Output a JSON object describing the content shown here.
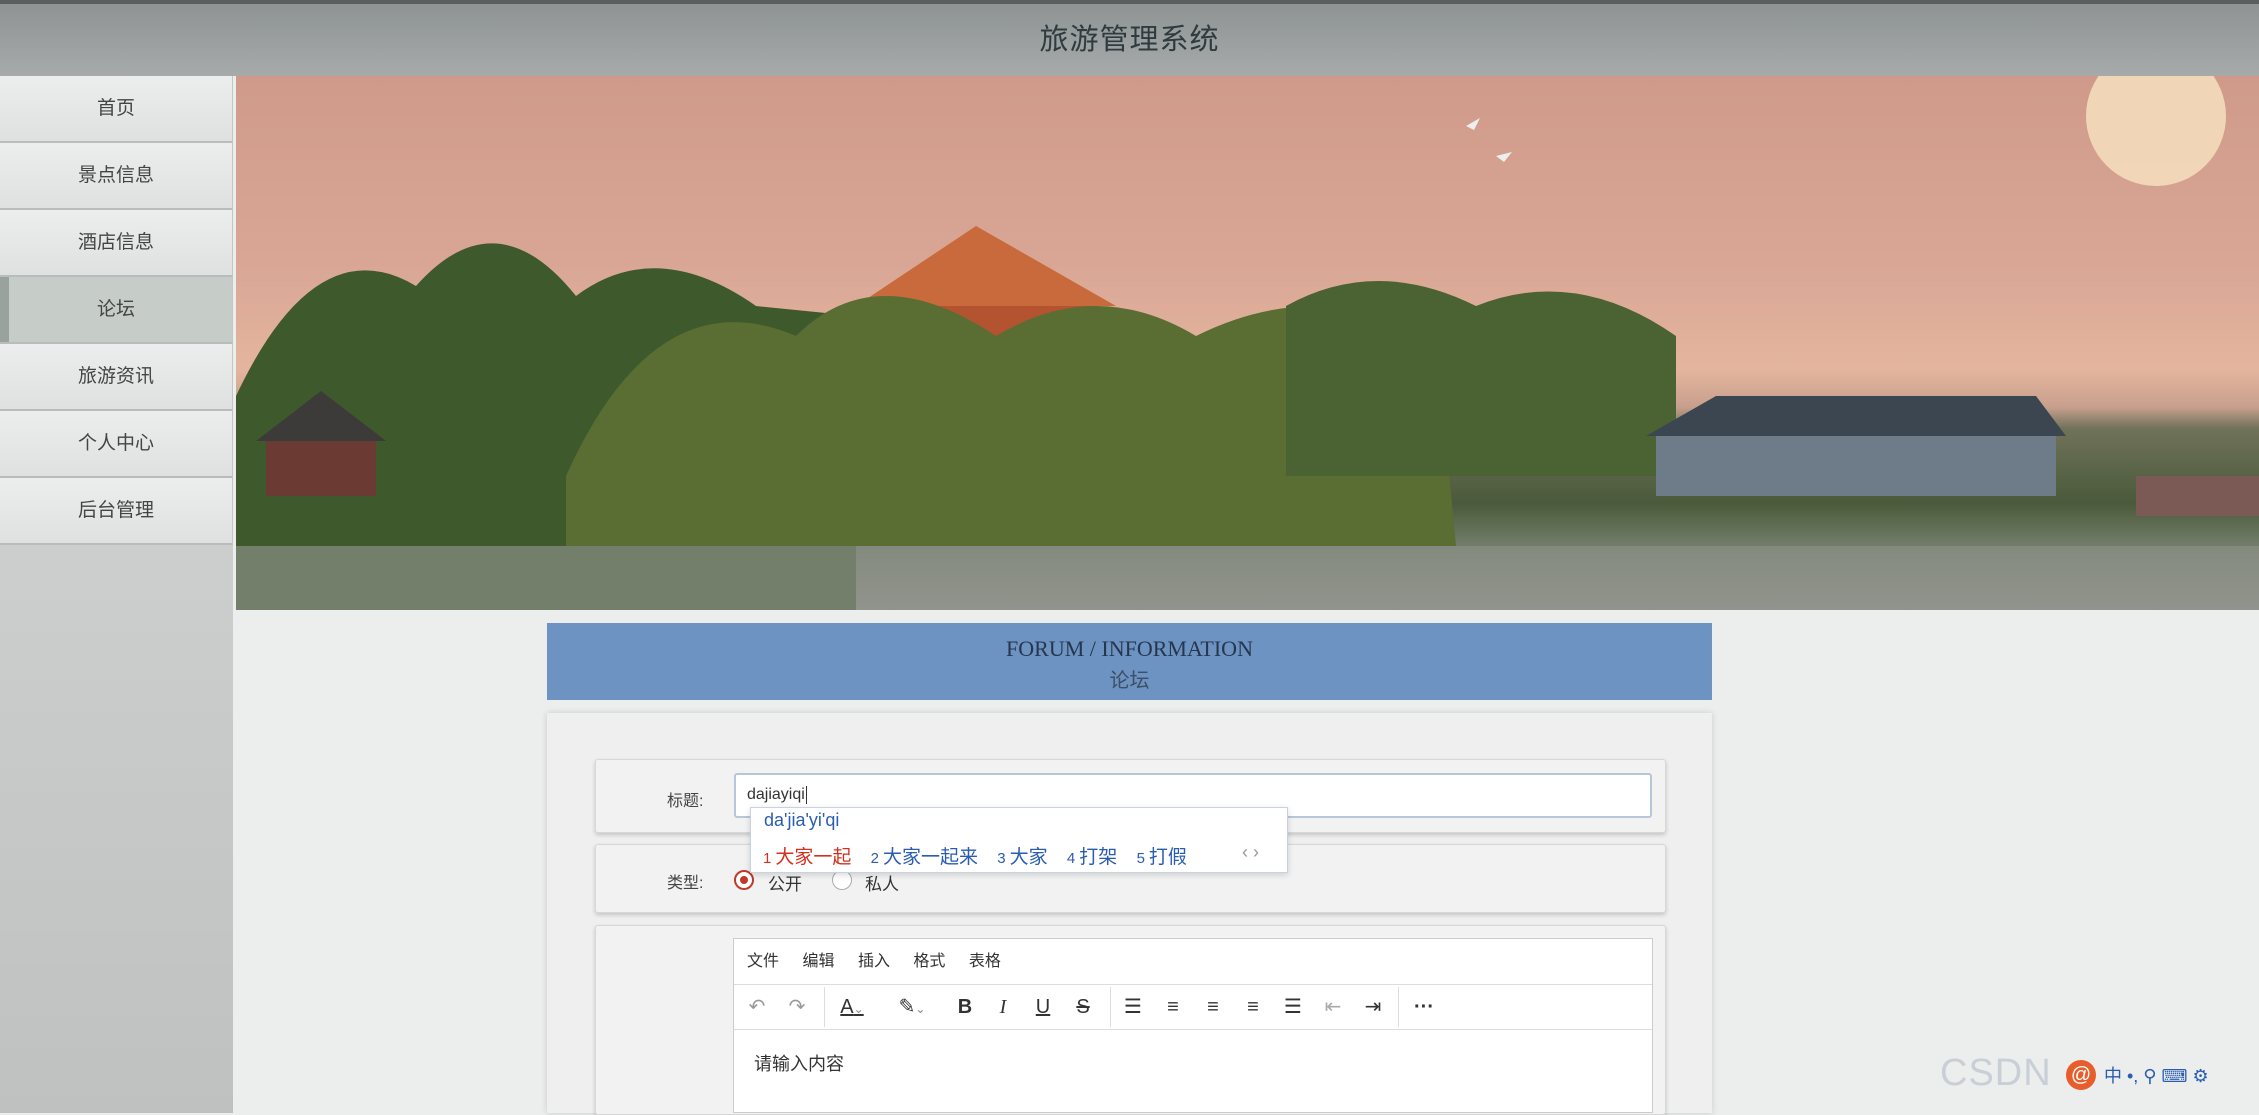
{
  "app": {
    "title": "旅游管理系统"
  },
  "sidebar": {
    "items": [
      {
        "label": "首页"
      },
      {
        "label": "景点信息"
      },
      {
        "label": "酒店信息"
      },
      {
        "label": "论坛",
        "active": true
      },
      {
        "label": "旅游资讯"
      },
      {
        "label": "个人中心"
      },
      {
        "label": "后台管理"
      }
    ]
  },
  "banner": {
    "slide_count": 3,
    "active_slide": 2
  },
  "forum": {
    "heading_en": "FORUM / INFORMATION",
    "heading_zh": "论坛"
  },
  "form": {
    "title_label": "标题:",
    "title_value": "dajiayiqi",
    "type_label": "类型:",
    "type_options": [
      {
        "label": "公开",
        "selected": true
      },
      {
        "label": "私人",
        "selected": false
      }
    ],
    "editor": {
      "menu": [
        "文件",
        "编辑",
        "插入",
        "格式",
        "表格"
      ],
      "placeholder": "请输入内容",
      "toolbar_icons": [
        "undo-icon",
        "redo-icon",
        "font-color-icon",
        "highlight-icon",
        "bold-icon",
        "italic-icon",
        "underline-icon",
        "strikethrough-icon",
        "line-height-icon",
        "align-left-icon",
        "align-center-icon",
        "align-right-icon",
        "justify-icon",
        "outdent-icon",
        "indent-icon",
        "more-icon"
      ]
    }
  },
  "ime": {
    "pinyin": "da'jia'yi'qi",
    "candidates": [
      {
        "index": "1",
        "text": "大家一起"
      },
      {
        "index": "2",
        "text": "大家一起来"
      },
      {
        "index": "3",
        "text": "大家"
      },
      {
        "index": "4",
        "text": "打架"
      },
      {
        "index": "5",
        "text": "打假"
      }
    ],
    "arrows": "‹ ›"
  },
  "watermark": {
    "text": "CSDN"
  },
  "colors": {
    "header_band": "#6c93c1",
    "active_radio": "#c0392b",
    "ime_first": "#d2311f"
  }
}
